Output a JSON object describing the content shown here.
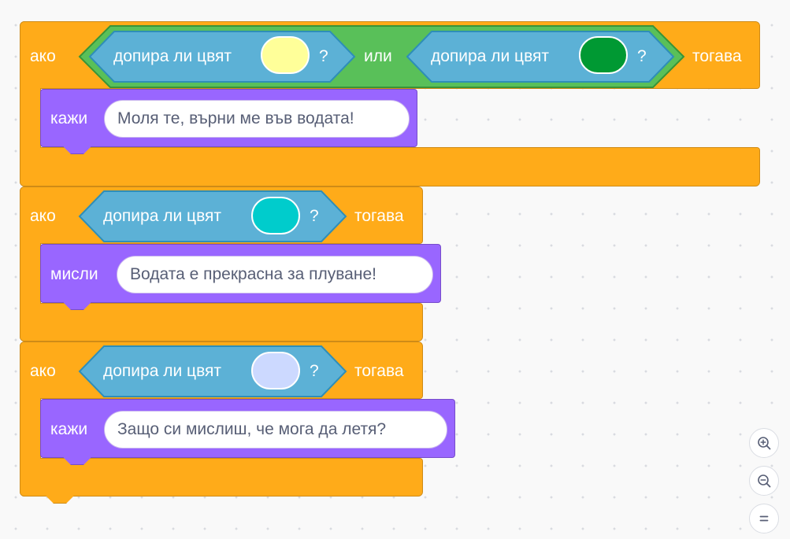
{
  "blocks": [
    {
      "keyword_if": "ако",
      "keyword_then": "тогава",
      "condition": {
        "operator": "или",
        "left": {
          "label": "допира ли цвят",
          "question": "?",
          "color": "#ffff99"
        },
        "right": {
          "label": "допира ли цвят",
          "question": "?",
          "color": "#009933"
        }
      },
      "action": {
        "verb": "кажи",
        "text": "Моля те, върни ме във водата!"
      }
    },
    {
      "keyword_if": "ако",
      "keyword_then": "тогава",
      "condition": {
        "label": "допира ли цвят",
        "question": "?",
        "color": "#00cccc"
      },
      "action": {
        "verb": "мисли",
        "text": "Водата е прекрасна за плуване!"
      }
    },
    {
      "keyword_if": "ако",
      "keyword_then": "тогава",
      "condition": {
        "label": "допира ли цвят",
        "question": "?",
        "color": "#ccd9ff"
      },
      "action": {
        "verb": "кажи",
        "text": "Защо си мислиш, че мога да летя?"
      }
    }
  ],
  "colors": {
    "control": "#ffab19",
    "operators": "#59c059",
    "sensing": "#5cb1d6",
    "looks": "#9966ff"
  },
  "zoom_controls": [
    {
      "icon": "zoom-in-icon"
    },
    {
      "icon": "zoom-out-icon"
    },
    {
      "icon": "zoom-reset-icon"
    }
  ]
}
